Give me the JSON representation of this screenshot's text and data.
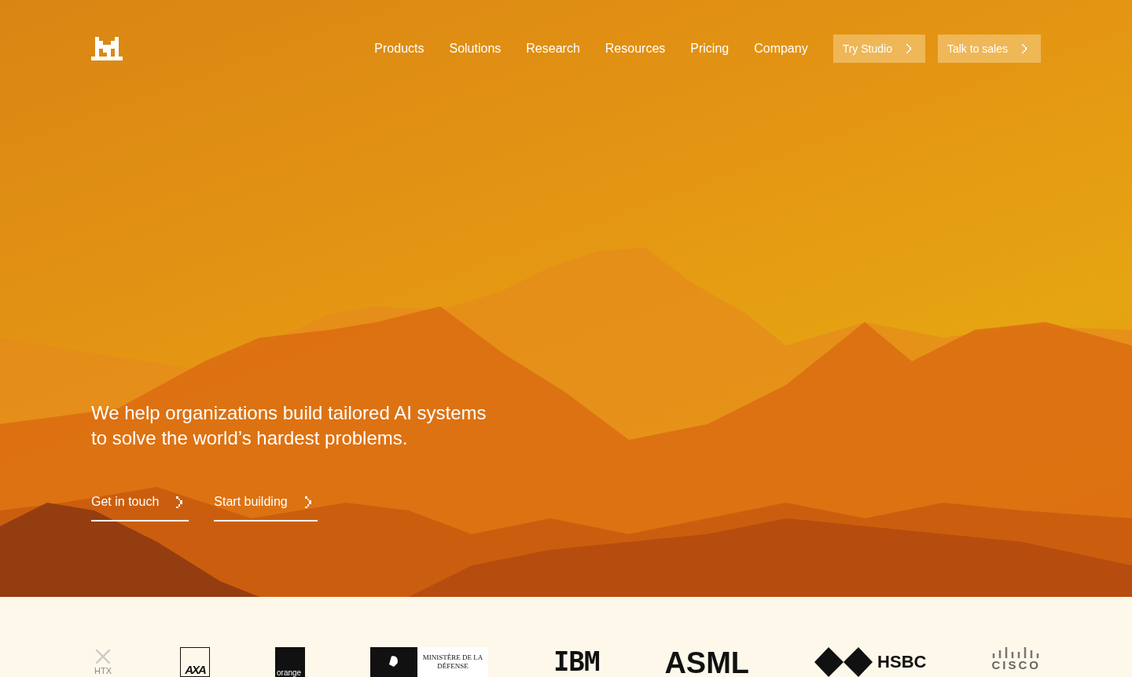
{
  "header": {
    "nav": [
      {
        "label": "Products"
      },
      {
        "label": "Solutions"
      },
      {
        "label": "Research"
      },
      {
        "label": "Resources"
      },
      {
        "label": "Pricing"
      },
      {
        "label": "Company"
      }
    ],
    "buttons": [
      {
        "label": "Try Studio"
      },
      {
        "label": "Talk to sales"
      }
    ]
  },
  "hero": {
    "headline": "We help organizations build tailored AI systems to solve the world’s hardest problems.",
    "links": [
      {
        "label": "Get in touch"
      },
      {
        "label": "Start building"
      }
    ]
  },
  "logos": [
    {
      "kind": "htx",
      "text": "HTX"
    },
    {
      "kind": "axa",
      "text": "AXA"
    },
    {
      "kind": "orange",
      "text": "orange"
    },
    {
      "kind": "ministere",
      "text": "MINISTÈRE DE LA DÉFENSE"
    },
    {
      "kind": "ibm",
      "text": "IBM"
    },
    {
      "kind": "asml",
      "text": "ASML"
    },
    {
      "kind": "hsbc",
      "text": "HSBC"
    },
    {
      "kind": "cisco",
      "text": "CISCO"
    }
  ]
}
